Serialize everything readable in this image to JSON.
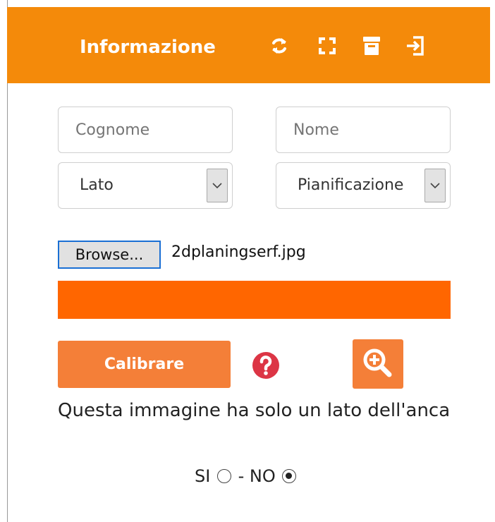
{
  "header": {
    "title": "Informazione",
    "color": "#f48a0a",
    "icons": [
      "refresh-icon",
      "fullscreen-icon",
      "archive-icon",
      "logout-icon"
    ]
  },
  "form": {
    "surname_placeholder": "Cognome",
    "name_placeholder": "Nome",
    "side_select": "Lato",
    "planning_select": "Pianificazione"
  },
  "file": {
    "browse_label": "Browse...",
    "filename": "2dplaningserf.jpg"
  },
  "progress": {
    "color": "#ff6600",
    "value": 1.0
  },
  "actions": {
    "calibrate_label": "Calibrare",
    "accent": "#f47f38",
    "help_icon": "question-circle-icon",
    "zoom_icon": "zoom-in-icon"
  },
  "question": {
    "text": "Questa immagine ha solo un lato dell'anca",
    "yes_label": "SI",
    "separator": "-",
    "no_label": "NO",
    "selected": "NO"
  }
}
